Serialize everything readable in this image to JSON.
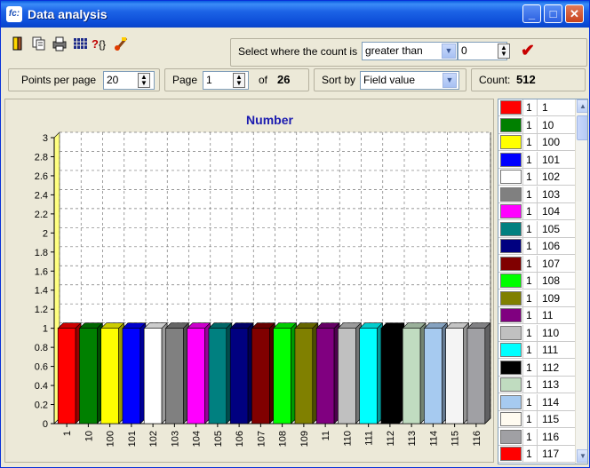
{
  "window": {
    "app_icon": "fc:",
    "title": "Data analysis",
    "minimize": "_",
    "maximize": "□",
    "close": "✕"
  },
  "toolbar": {
    "icons": [
      "exit-icon",
      "copy-icon",
      "print-icon",
      "grid-icon",
      "help-icon",
      "clear-icon"
    ],
    "filter_label": "Select where the count is",
    "filter_condition": "greater than",
    "filter_value": "0",
    "apply_icon": "checkmark-icon",
    "apply_symbol": "✔"
  },
  "paging": {
    "points_label": "Points per page",
    "points_value": "20",
    "page_label": "Page",
    "page_value": "1",
    "of_label": "of",
    "page_total": "26",
    "sort_label": "Sort by",
    "sort_value": "Field value",
    "count_label": "Count:",
    "count_value": "512"
  },
  "chart_data": {
    "type": "bar",
    "title": "Number",
    "categories": [
      "1",
      "10",
      "100",
      "101",
      "102",
      "103",
      "104",
      "105",
      "106",
      "107",
      "108",
      "109",
      "11",
      "110",
      "111",
      "112",
      "113",
      "114",
      "115",
      "116"
    ],
    "values": [
      1,
      1,
      1,
      1,
      1,
      1,
      1,
      1,
      1,
      1,
      1,
      1,
      1,
      1,
      1,
      1,
      1,
      1,
      1,
      1
    ],
    "colors": [
      "#ff0000",
      "#008000",
      "#ffff00",
      "#0000ff",
      "#ffffff",
      "#808080",
      "#ff00ff",
      "#008080",
      "#000080",
      "#800000",
      "#00ff00",
      "#808000",
      "#800080",
      "#c0c0c0",
      "#00ffff",
      "#000000",
      "#c0dcc0",
      "#a6caf0",
      "#f4f4f4",
      "#a0a0a4"
    ],
    "y_ticks": [
      "0",
      "0.2",
      "0.4",
      "0.6",
      "0.8",
      "1",
      "1.2",
      "1.4",
      "1.6",
      "1.8",
      "2",
      "2.2",
      "2.4",
      "2.6",
      "2.8",
      "3"
    ],
    "ylim": [
      0,
      3
    ],
    "grid": true,
    "legend": "right"
  },
  "legend": {
    "rows": [
      {
        "count": "1",
        "name": "1",
        "color": "#ff0000"
      },
      {
        "count": "1",
        "name": "10",
        "color": "#008000"
      },
      {
        "count": "1",
        "name": "100",
        "color": "#ffff00"
      },
      {
        "count": "1",
        "name": "101",
        "color": "#0000ff"
      },
      {
        "count": "1",
        "name": "102",
        "color": "#ffffff"
      },
      {
        "count": "1",
        "name": "103",
        "color": "#808080"
      },
      {
        "count": "1",
        "name": "104",
        "color": "#ff00ff"
      },
      {
        "count": "1",
        "name": "105",
        "color": "#008080"
      },
      {
        "count": "1",
        "name": "106",
        "color": "#000080"
      },
      {
        "count": "1",
        "name": "107",
        "color": "#800000"
      },
      {
        "count": "1",
        "name": "108",
        "color": "#00ff00"
      },
      {
        "count": "1",
        "name": "109",
        "color": "#808000"
      },
      {
        "count": "1",
        "name": "11",
        "color": "#800080"
      },
      {
        "count": "1",
        "name": "110",
        "color": "#c0c0c0"
      },
      {
        "count": "1",
        "name": "111",
        "color": "#00ffff"
      },
      {
        "count": "1",
        "name": "112",
        "color": "#000000"
      },
      {
        "count": "1",
        "name": "113",
        "color": "#c0dcc0"
      },
      {
        "count": "1",
        "name": "114",
        "color": "#a6caf0"
      },
      {
        "count": "1",
        "name": "115",
        "color": "#fffbf0"
      },
      {
        "count": "1",
        "name": "116",
        "color": "#a0a0a4"
      },
      {
        "count": "1",
        "name": "117",
        "color": "#ff0000"
      }
    ]
  }
}
